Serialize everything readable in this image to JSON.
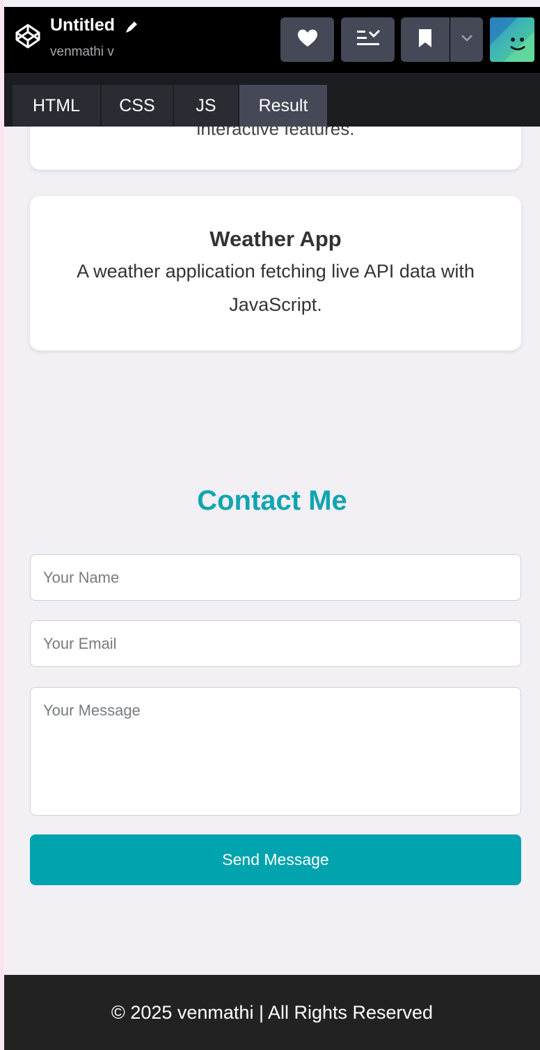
{
  "header": {
    "title": "Untitled",
    "author": "venmathi v"
  },
  "tabs": [
    {
      "label": "HTML"
    },
    {
      "label": "CSS"
    },
    {
      "label": "JS"
    },
    {
      "label": "Result"
    }
  ],
  "active_tab": "Result",
  "projects": {
    "previous_card_text": "interactive features.",
    "weather": {
      "title": "Weather App",
      "description": "A weather application fetching live API data with JavaScript."
    }
  },
  "contact": {
    "title": "Contact Me",
    "name_placeholder": "Your Name",
    "email_placeholder": "Your Email",
    "message_placeholder": "Your Message",
    "send_label": "Send Message"
  },
  "footer": {
    "text": "© 2025 venmathi | All Rights Reserved"
  },
  "colors": {
    "accent": "#01a3ae",
    "contact_title": "#0ea5b0",
    "header_bg": "#000000",
    "footer_bg": "#222222",
    "page_bg": "#f2eff5"
  },
  "icons": {
    "logo": "codepen-logo-icon",
    "edit": "pencil-icon",
    "heart": "heart-icon",
    "layout": "layout-list-icon",
    "bookmark": "bookmark-icon",
    "dropdown": "chevron-down-icon",
    "avatar": "avatar"
  }
}
